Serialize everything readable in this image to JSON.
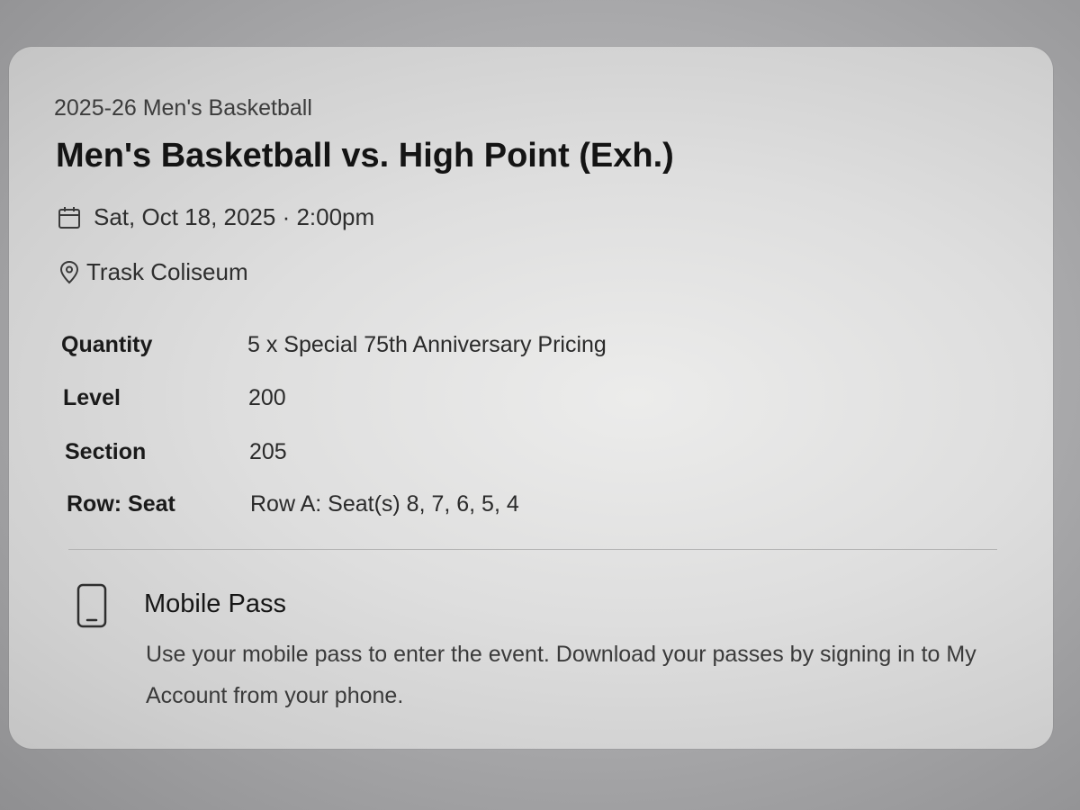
{
  "event": {
    "season": "2025-26 Men's Basketball",
    "title": "Men's Basketball vs. High Point (Exh.)",
    "datetime": "Sat, Oct 18, 2025 · 2:00pm",
    "venue": "Trask Coliseum"
  },
  "details": [
    {
      "label": "Quantity",
      "value": "5 x Special 75th Anniversary Pricing"
    },
    {
      "label": "Level",
      "value": "200"
    },
    {
      "label": "Section",
      "value": "205"
    },
    {
      "label": "Row: Seat",
      "value": "Row A: Seat(s) 8, 7, 6, 5, 4"
    }
  ],
  "mobile_pass": {
    "title": "Mobile Pass",
    "description": "Use your mobile pass to enter the event. Download your passes by signing in to My Account from your phone."
  },
  "icons": {
    "date": "calendar-icon",
    "venue": "map-pin-icon",
    "pass": "mobile-phone-icon"
  }
}
